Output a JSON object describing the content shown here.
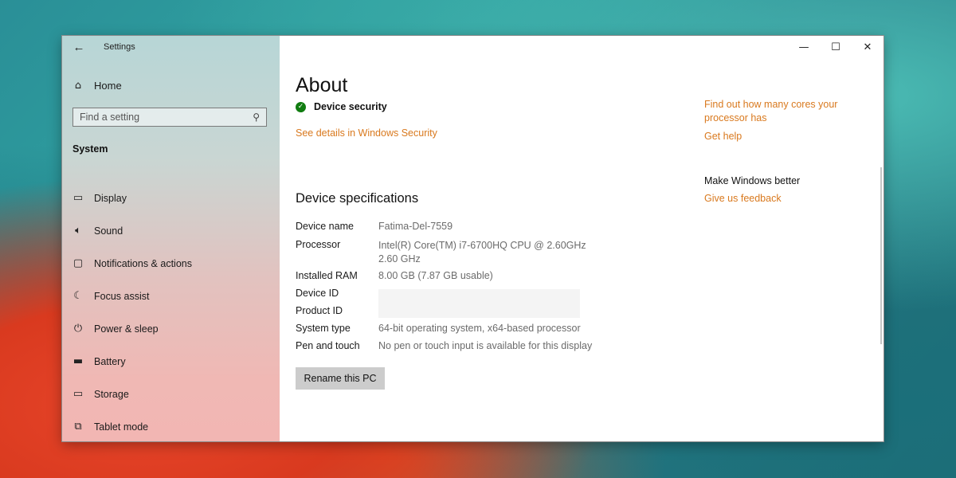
{
  "window": {
    "title": "Settings",
    "controls": {
      "minimize": "—",
      "maximize": "☐",
      "close": "✕"
    }
  },
  "sidebar": {
    "home_label": "Home",
    "search_placeholder": "Find a setting",
    "section_label": "System",
    "items": [
      {
        "label": "Display",
        "icon": "monitor-icon"
      },
      {
        "label": "Sound",
        "icon": "speaker-icon"
      },
      {
        "label": "Notifications & actions",
        "icon": "notification-icon"
      },
      {
        "label": "Focus assist",
        "icon": "moon-icon"
      },
      {
        "label": "Power & sleep",
        "icon": "power-icon"
      },
      {
        "label": "Battery",
        "icon": "battery-icon"
      },
      {
        "label": "Storage",
        "icon": "storage-icon"
      },
      {
        "label": "Tablet mode",
        "icon": "tablet-mode-icon"
      }
    ]
  },
  "main": {
    "title": "About",
    "device_security_label": "Device security",
    "security_link": "See details in Windows Security",
    "spec_heading": "Device specifications",
    "specs": [
      {
        "key": "Device name",
        "value": "Fatima-Del-7559"
      },
      {
        "key": "Processor",
        "value": "Intel(R) Core(TM) i7-6700HQ CPU @ 2.60GHz",
        "value2": "2.60 GHz"
      },
      {
        "key": "Installed RAM",
        "value": "8.00 GB (7.87 GB usable)"
      },
      {
        "key": "Device ID",
        "value": ""
      },
      {
        "key": "Product ID",
        "value": ""
      },
      {
        "key": "System type",
        "value": "64-bit operating system, x64-based processor"
      },
      {
        "key": "Pen and touch",
        "value": "No pen or touch input is available for this display"
      }
    ],
    "rename_button": "Rename this PC"
  },
  "right": {
    "cores_link": "Find out how many cores your processor has",
    "help_link": "Get help",
    "better_heading": "Make Windows better",
    "feedback_link": "Give us feedback"
  },
  "colors": {
    "accent_link": "#d9791e",
    "security_ok": "#107c10"
  }
}
